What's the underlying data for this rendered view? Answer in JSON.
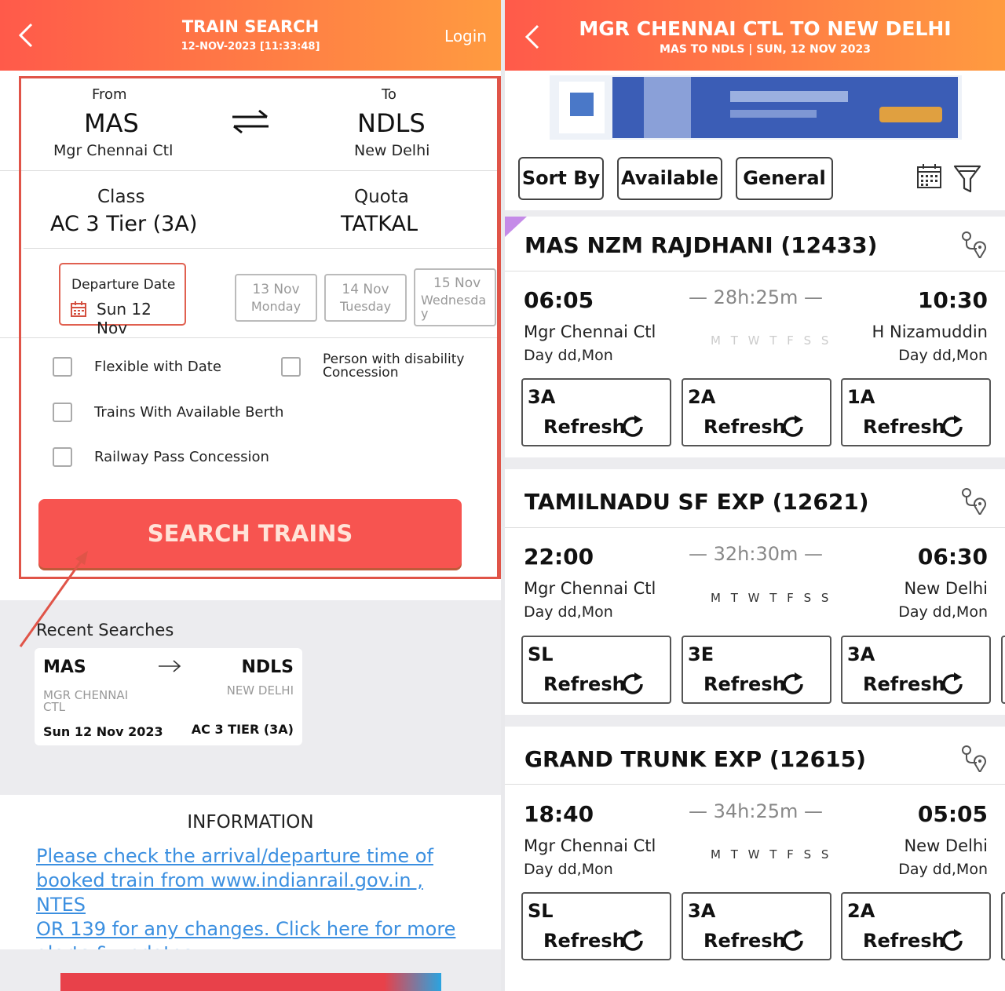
{
  "left": {
    "header": {
      "title": "TRAIN SEARCH",
      "subtitle": "12-NOV-2023 [11:33:48]",
      "login": "Login"
    },
    "from": {
      "label": "From",
      "code": "MAS",
      "name": "Mgr Chennai Ctl"
    },
    "to": {
      "label": "To",
      "code": "NDLS",
      "name": "New Delhi"
    },
    "class": {
      "label": "Class",
      "value": "AC 3 Tier (3A)"
    },
    "quota": {
      "label": "Quota",
      "value": "TATKAL"
    },
    "departure": {
      "label": "Departure Date",
      "value": "Sun 12 Nov"
    },
    "dates": [
      {
        "date": "13 Nov",
        "day": "Monday"
      },
      {
        "date": "14 Nov",
        "day": "Tuesday"
      },
      {
        "date": "15 Nov",
        "day": "Wednesda",
        "day2": "y"
      }
    ],
    "options": {
      "flexible": "Flexible with Date",
      "disability_1": "Person with disability",
      "disability_2": "Concession",
      "berth": "Trains With Available Berth",
      "pass": "Railway Pass Concession"
    },
    "search_button": "SEARCH TRAINS",
    "recent": {
      "title": "Recent Searches",
      "from_code": "MAS",
      "from_name_1": "MGR CHENNAI",
      "from_name_2": "CTL",
      "to_code": "NDLS",
      "to_name": "NEW DELHI",
      "date": "Sun 12 Nov 2023",
      "class": "AC 3 TIER (3A)"
    },
    "info": {
      "title": "INFORMATION",
      "line1": "Please check the arrival/departure time of",
      "line2": "booked train from www.indianrail.gov.in , NTES",
      "line3": "OR 139 for any changes. Click here for more",
      "line4": "alerts & updates."
    }
  },
  "right": {
    "header": {
      "title": "MGR CHENNAI CTL TO NEW DELHI",
      "subtitle": "MAS TO NDLS | SUN, 12 NOV  2023"
    },
    "filters": {
      "sort": "Sort By",
      "available": "Available",
      "general": "General"
    },
    "trains": [
      {
        "name": "MAS NZM RAJDHANI (12433)",
        "dep": "06:05",
        "arr": "10:30",
        "duration": "28h:25m",
        "from": "Mgr Chennai Ctl",
        "to": "H Nizamuddin",
        "from_day": "Day dd,Mon",
        "to_day": "Day dd,Mon",
        "days": "M T W T F S S",
        "classes": [
          {
            "code": "3A",
            "action": "Refresh"
          },
          {
            "code": "2A",
            "action": "Refresh"
          },
          {
            "code": "1A",
            "action": "Refresh"
          }
        ]
      },
      {
        "name": "TAMILNADU SF EXP (12621)",
        "dep": "22:00",
        "arr": "06:30",
        "duration": "32h:30m",
        "from": "Mgr Chennai Ctl",
        "to": "New Delhi",
        "from_day": "Day dd,Mon",
        "to_day": "Day dd,Mon",
        "days": "M T W T F S S",
        "classes": [
          {
            "code": "SL",
            "action": "Refresh"
          },
          {
            "code": "3E",
            "action": "Refresh"
          },
          {
            "code": "3A",
            "action": "Refresh"
          }
        ]
      },
      {
        "name": "GRAND TRUNK EXP (12615)",
        "dep": "18:40",
        "arr": "05:05",
        "duration": "34h:25m",
        "from": "Mgr Chennai Ctl",
        "to": "New Delhi",
        "from_day": "Day dd,Mon",
        "to_day": "Day dd,Mon",
        "days": "M T W T F S S",
        "classes": [
          {
            "code": "SL",
            "action": "Refresh"
          },
          {
            "code": "3A",
            "action": "Refresh"
          },
          {
            "code": "2A",
            "action": "Refresh"
          }
        ]
      }
    ]
  },
  "colors": {
    "header_start": "#ff5a4a",
    "header_end": "#ff9b40",
    "search_button": "#f75450",
    "link": "#3b8fe0",
    "highlight_box": "#e05448"
  },
  "icons": [
    "back-arrow-icon",
    "swap-icon",
    "calendar-icon",
    "arrow-right-icon",
    "route-map-icon",
    "refresh-icon",
    "filter-icon"
  ]
}
